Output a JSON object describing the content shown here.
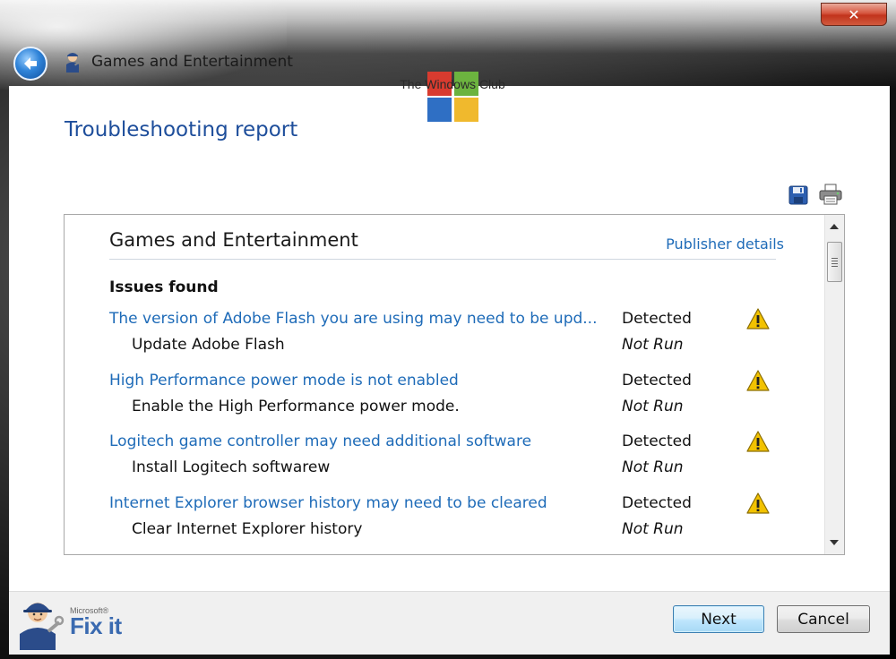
{
  "window": {
    "title": "Games and Entertainment",
    "close_label": "✕"
  },
  "watermark": {
    "text": "The Windows Club"
  },
  "page": {
    "heading": "Troubleshooting report"
  },
  "report": {
    "section_title": "Games and Entertainment",
    "publisher_link": "Publisher details",
    "issues_label": "Issues found",
    "issues": [
      {
        "title": "The version of Adobe Flash you are using may need to be upd...",
        "status": "Detected",
        "fix": "Update Adobe Flash",
        "fix_status": "Not Run"
      },
      {
        "title": "High Performance power mode is not enabled",
        "status": "Detected",
        "fix": "Enable the High Performance power mode.",
        "fix_status": "Not Run"
      },
      {
        "title": "Logitech game controller may need additional software",
        "status": "Detected",
        "fix": "Install Logitech softwarew",
        "fix_status": "Not Run"
      },
      {
        "title": "Internet Explorer browser history may need to be cleared",
        "status": "Detected",
        "fix": "Clear Internet Explorer history",
        "fix_status": "Not Run"
      }
    ]
  },
  "footer": {
    "brand_small": "Microsoft®",
    "brand": "Fix it",
    "next_label": "Next",
    "cancel_label": "Cancel"
  },
  "colors": {
    "link": "#1e6bb8",
    "heading": "#1e4e9b",
    "warning": "#f2c200"
  }
}
